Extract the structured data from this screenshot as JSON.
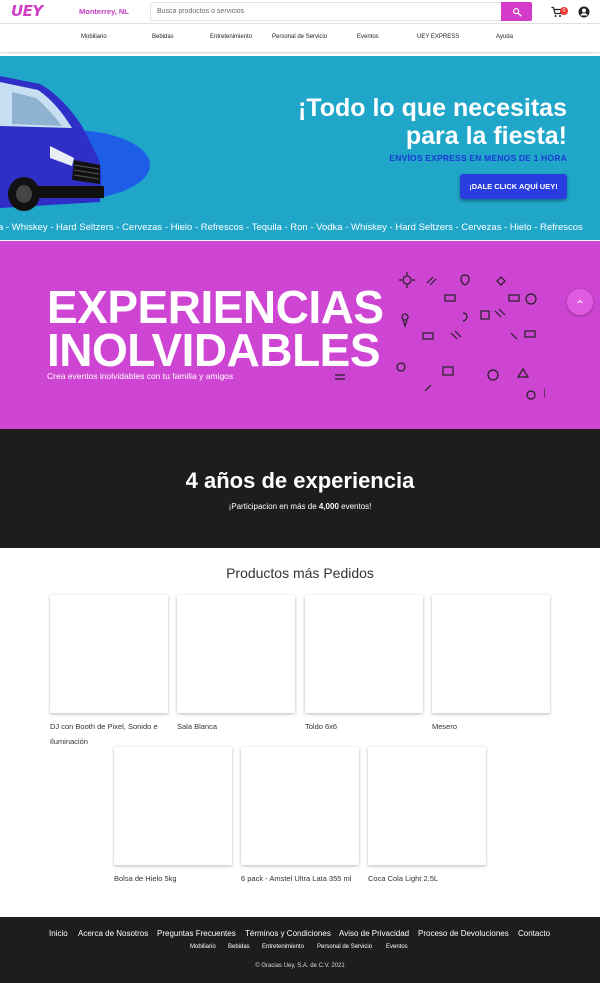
{
  "header": {
    "logo": "UEY",
    "city": "Monterrey, NL",
    "search_placeholder": "Busca productos o servicios",
    "cart_count": "0"
  },
  "nav": {
    "items": [
      "Mobiliario",
      "Bebidas",
      "Entretenimiento",
      "Personal de Servicio",
      "Eventos",
      "UEY EXPRESS",
      "Ayuda"
    ]
  },
  "hero": {
    "title_line1": "¡Todo lo que necesitas",
    "title_line2": "para la fiesta!",
    "subtitle": "ENVÍOS EXPRESS EN MENOS DE 1 HORA",
    "cta": "¡DALE CLICK AQUÍ UEY!",
    "ticker": "a - Whiskey - Hard Seltzers - Cervezas - Hielo - Refrescos - Tequila - Ron - Vodka - Whiskey - Hard Seltzers - Cervezas - Hielo - Refrescos",
    "colors": {
      "background": "#1fa6c8",
      "accent": "#2a3de0"
    }
  },
  "experiences": {
    "title_line1": "EXPERIENCIAS",
    "title_line2": "INOLVIDABLES",
    "subtitle": "Crea eventos inolvidables con tu familia y amigos",
    "colors": {
      "background": "#cf45d3"
    }
  },
  "stats": {
    "title": "4 años de experiencia",
    "sub_prefix": "¡Participacion en más de ",
    "sub_bold": "4,000",
    "sub_suffix": " eventos!"
  },
  "products": {
    "title": "Productos más Pedidos",
    "items": [
      {
        "name": "DJ con Booth de Pixel, Sonido e Iluminación"
      },
      {
        "name": "Sala Blanca"
      },
      {
        "name": "Toldo 6x6"
      },
      {
        "name": "Mesero"
      },
      {
        "name": "Bolsa de Hielo 5kg"
      },
      {
        "name": "6 pack - Amstel Ultra Lata 355 ml"
      },
      {
        "name": "Coca Cola Light 2.5L"
      }
    ]
  },
  "footer": {
    "links": [
      "Inicio",
      "Acerca de Nosotros",
      "Preguntas Frecuentes",
      "Términos y Condiciones",
      "Aviso de Privacidad",
      "Proceso de Devoluciones",
      "Contacto"
    ],
    "sublinks": [
      "Mobiliario",
      "Bebidas",
      "Entretenimiento",
      "Personal de Servicio",
      "Eventos"
    ],
    "copyright": "© Gracias Uey, S.A. de C.V. 2021"
  },
  "colors": {
    "brand": "#d43bc8",
    "dark": "#1d1d1d"
  }
}
